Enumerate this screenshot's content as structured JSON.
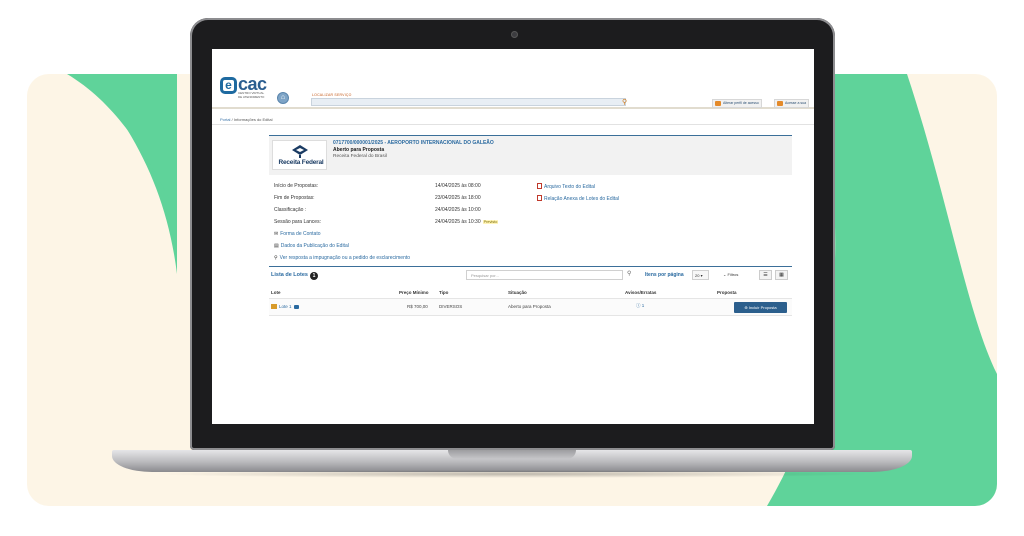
{
  "colors": {
    "accent_green": "#5fd39a",
    "cream": "#fdf5e6",
    "link_blue": "#2a6aa0",
    "header_border": "#3b6f99",
    "button_blue": "#2c5f8d"
  },
  "header": {
    "logo_text": "cac",
    "logo_subtitle": "CENTRO VIRTUAL DE ATENDIMENTO",
    "search_label": "LOCALIZAR SERVIÇO",
    "search_value": "",
    "btn_profile": "Alterar perfil de acesso",
    "btn_access": "Acesse a sua"
  },
  "breadcrumb": {
    "home": "Portal",
    "sep": "/",
    "current": "Informações do Edital"
  },
  "edital": {
    "logo_text": "Receita Federal",
    "title": "0717700/000001/2025 - AEROPORTO INTERNACIONAL DO GALEÃO",
    "status": "Aberto para Proposta",
    "org": "Receita Federal do Brasil"
  },
  "info": {
    "inicio_label": "Início de Propostas:",
    "inicio_value": "14/04/2025 às 08:00",
    "fim_label": "Fim de Propostas:",
    "fim_value": "23/04/2025 às 18:00",
    "classif_label": "Classificação :",
    "classif_value": "24/04/2025 às 10:00",
    "sessao_label": "Sessão para Lances:",
    "sessao_value": "24/04/2025 às 10:30",
    "previsto": "Previsto"
  },
  "docs": {
    "arquivo": "Arquivo Texto do Edital",
    "relacao": "Relação Anexa de Lotes do Edital"
  },
  "actions": {
    "contato": "Forma de Contato",
    "publicacao": "Dados da Publicação do Edital",
    "resposta": "Ver resposta a impugnação ou a pedido de esclarecimento"
  },
  "lotes": {
    "title": "Lista de Lotes",
    "count": "1",
    "search_placeholder": "Pesquisar por...",
    "per_page_label": "Itens por página",
    "per_page_value": "20",
    "filtros": "Filtros",
    "columns": {
      "lote": "Lote",
      "preco": "Preço Mínimo",
      "tipo": "Tipo",
      "situacao": "Situação",
      "avisos": "Avisos/Erratas",
      "proposta": "Proposta"
    },
    "rows": [
      {
        "lote": "Lote 1",
        "preco": "R$ 700,00",
        "tipo": "DIVERSOS",
        "situacao": "Aberto para Proposta",
        "avisos": "1",
        "proposta_btn": "Incluir Proposta"
      }
    ]
  }
}
